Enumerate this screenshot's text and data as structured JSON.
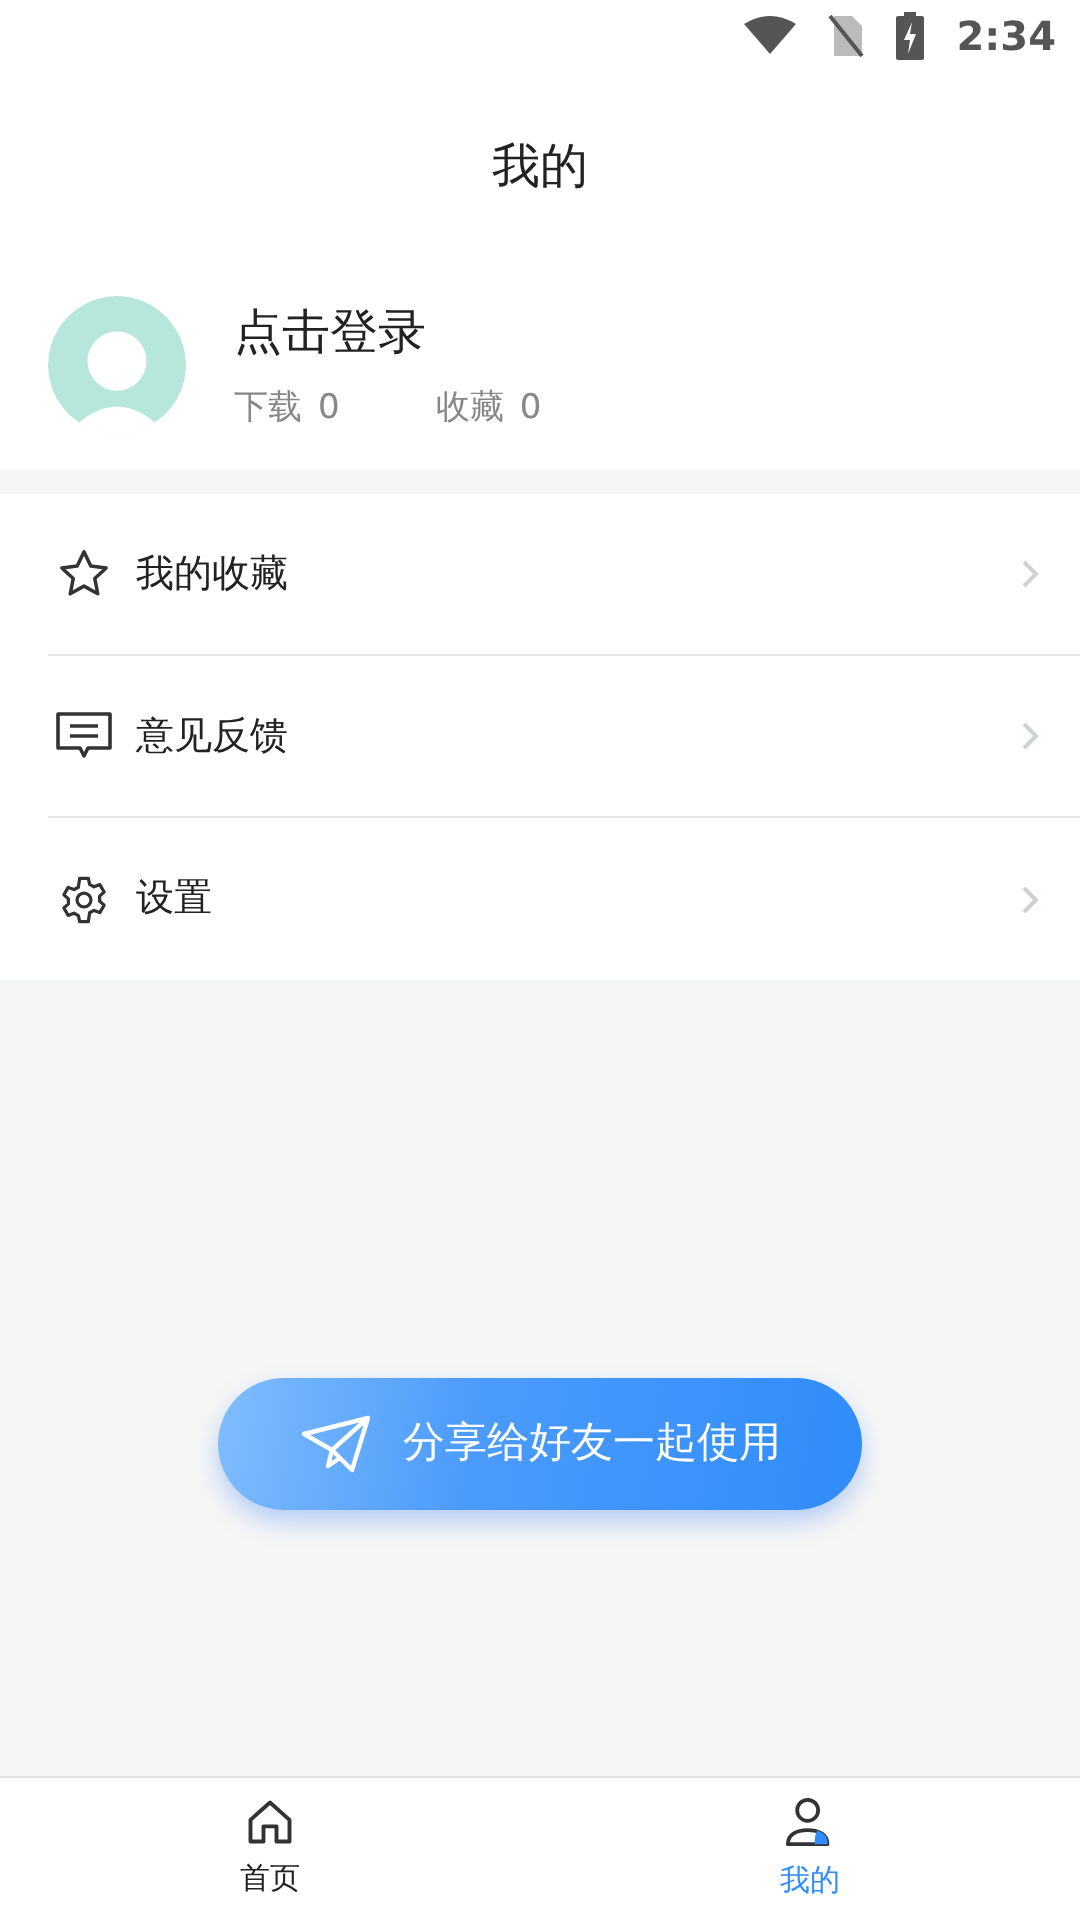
{
  "status_bar": {
    "time": "2:34"
  },
  "header": {
    "title": "我的"
  },
  "profile": {
    "name": "点击登录",
    "stats": [
      {
        "label": "下载",
        "value": "0"
      },
      {
        "label": "收藏",
        "value": "0"
      }
    ]
  },
  "menu": [
    {
      "kind": "star",
      "label": "我的收藏"
    },
    {
      "kind": "message",
      "label": "意见反馈"
    },
    {
      "kind": "gear",
      "label": "设置"
    }
  ],
  "share_button": {
    "label": "分享给好友一起使用"
  },
  "tabs": [
    {
      "kind": "home",
      "label": "首页",
      "selected": false
    },
    {
      "kind": "user",
      "label": "我的",
      "selected": true
    }
  ]
}
